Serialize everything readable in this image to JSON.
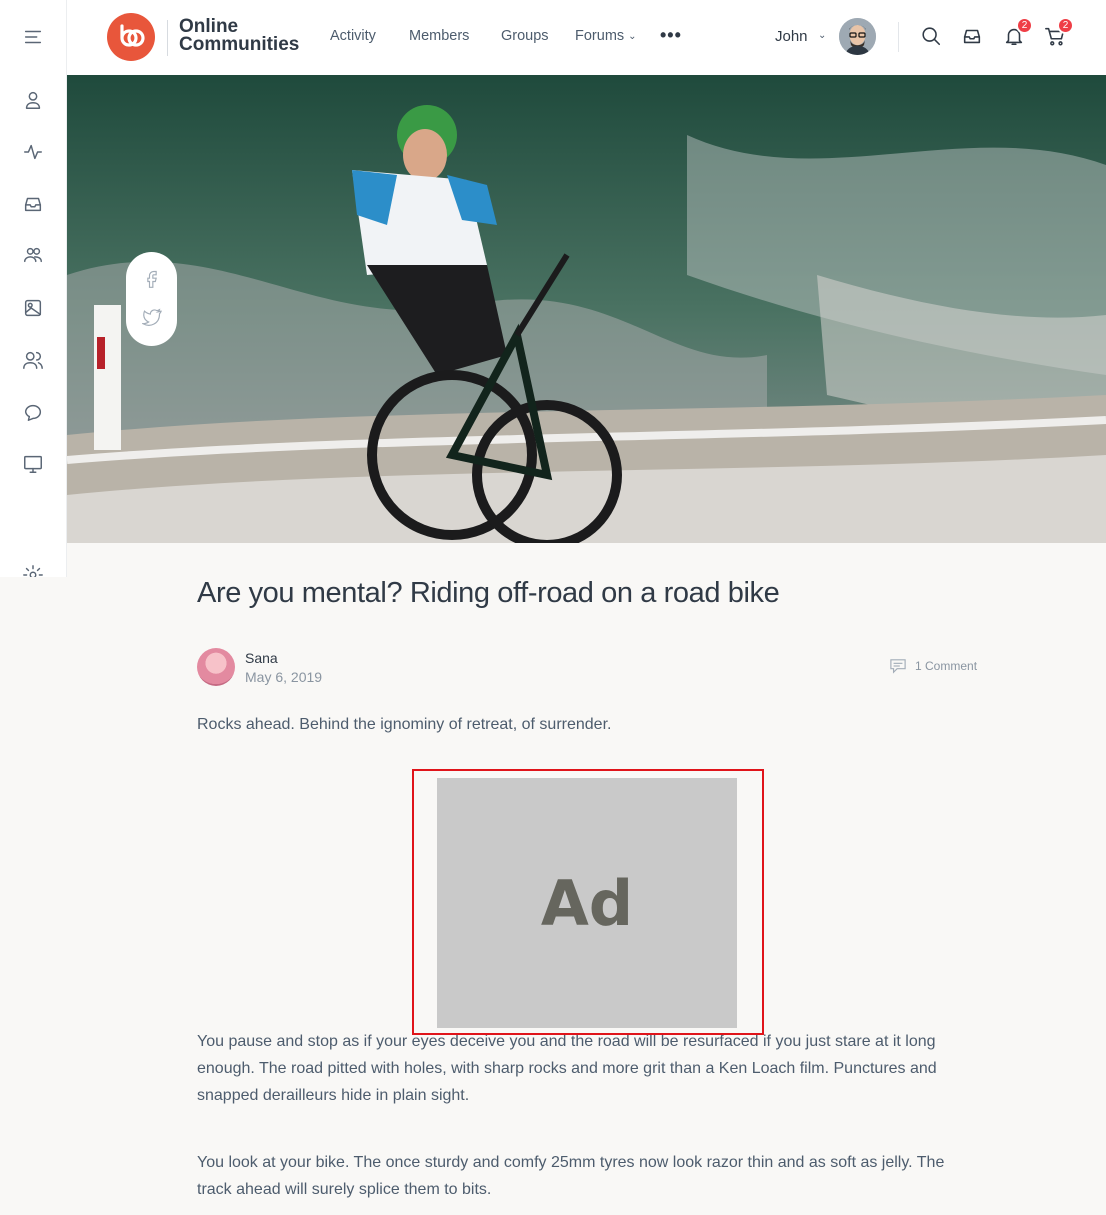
{
  "brand": {
    "line1": "Online",
    "line2": "Communities",
    "accent_color": "#e8563b"
  },
  "nav": {
    "items": [
      {
        "label": "Activity"
      },
      {
        "label": "Members"
      },
      {
        "label": "Groups"
      },
      {
        "label": "Forums"
      }
    ],
    "more_icon": "more-dots-icon"
  },
  "user": {
    "name": "John"
  },
  "header_icons": {
    "notifications_count": "2",
    "cart_count": "2"
  },
  "sidebar": {
    "icons": [
      "menu-icon",
      "profile-icon",
      "activity-icon",
      "inbox-icon",
      "groups-icon",
      "photos-icon",
      "members-icon",
      "forums-icon",
      "courses-icon",
      "settings-icon"
    ]
  },
  "article": {
    "title": "Are you mental? Riding off-road on a road bike",
    "author": "Sana",
    "date": "May 6, 2019",
    "comments": "1 Comment",
    "paragraphs": [
      "Rocks ahead. Behind the ignominy of retreat, of surrender.",
      "You pause and stop as if your eyes deceive you and the road will be resurfaced if you just stare at it long enough. The road pitted with holes, with sharp rocks and more grit than a Ken Loach film. Punctures and snapped derailleurs hide in plain sight.",
      "You look at your bike. The once sturdy and comfy 25mm tyres now look razor thin and as soft as jelly. The track ahead will surely splice them to bits."
    ]
  },
  "ad": {
    "label": "Ad"
  }
}
